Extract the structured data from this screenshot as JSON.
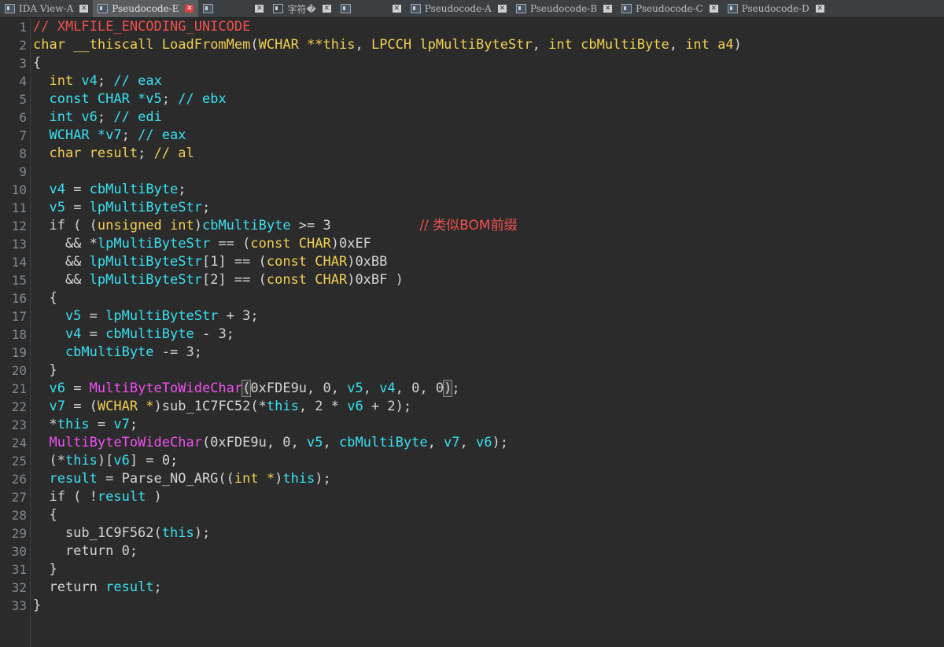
{
  "tabs": [
    {
      "label": "IDA View-A",
      "active": false,
      "icon": "ida-view-icon"
    },
    {
      "label": "Pseudocode-E",
      "active": true,
      "icon": "pseudocode-icon"
    },
    {
      "label": "",
      "active": false,
      "icon": "struct-icon"
    },
    {
      "label": "字符�",
      "active": false,
      "icon": "blank-icon"
    },
    {
      "label": "",
      "active": false,
      "icon": "hex-icon"
    },
    {
      "label": "Pseudocode-A",
      "active": false,
      "icon": "pseudocode-icon"
    },
    {
      "label": "Pseudocode-B",
      "active": false,
      "icon": "pseudocode-icon"
    },
    {
      "label": "Pseudocode-C",
      "active": false,
      "icon": "pseudocode-icon"
    },
    {
      "label": "Pseudocode-D",
      "active": false,
      "icon": "pseudocode-icon"
    }
  ],
  "close_glyph": "✕",
  "colors": {
    "comment": "#f05050",
    "keyword": "#f0d050",
    "variable": "#38e0f0",
    "function": "#f050f0",
    "text": "#d4d4d4",
    "background": "#2b2b2b"
  },
  "lines": [
    {
      "n": "1",
      "tokens": [
        {
          "t": "// XMLFILE_ENCODING_UNICODE",
          "c": "comment"
        }
      ]
    },
    {
      "n": "2",
      "tokens": [
        {
          "t": "char ",
          "c": "keyword"
        },
        {
          "t": "__thiscall ",
          "c": "keyword"
        },
        {
          "t": "LoadFromMem",
          "c": "keyword"
        },
        {
          "t": "(",
          "c": "plain"
        },
        {
          "t": "WCHAR **",
          "c": "keyword"
        },
        {
          "t": "this",
          "c": "keyword"
        },
        {
          "t": ", ",
          "c": "plain"
        },
        {
          "t": "LPCCH ",
          "c": "keyword"
        },
        {
          "t": "lpMultiByteStr",
          "c": "keyword"
        },
        {
          "t": ", ",
          "c": "plain"
        },
        {
          "t": "int ",
          "c": "keyword"
        },
        {
          "t": "cbMultiByte",
          "c": "keyword"
        },
        {
          "t": ", ",
          "c": "plain"
        },
        {
          "t": "int ",
          "c": "keyword"
        },
        {
          "t": "a4",
          "c": "keyword"
        },
        {
          "t": ")",
          "c": "plain"
        }
      ]
    },
    {
      "n": "3",
      "tokens": [
        {
          "t": "{",
          "c": "plain"
        }
      ]
    },
    {
      "n": "4",
      "tokens": [
        {
          "t": "  int ",
          "c": "keyword"
        },
        {
          "t": "v4",
          "c": "var"
        },
        {
          "t": "; ",
          "c": "plain"
        },
        {
          "t": "// eax",
          "c": "var"
        }
      ]
    },
    {
      "n": "5",
      "tokens": [
        {
          "t": "  const CHAR *",
          "c": "var"
        },
        {
          "t": "v5",
          "c": "var"
        },
        {
          "t": "; ",
          "c": "plain"
        },
        {
          "t": "// ebx",
          "c": "var"
        }
      ]
    },
    {
      "n": "6",
      "tokens": [
        {
          "t": "  int ",
          "c": "var"
        },
        {
          "t": "v6",
          "c": "var"
        },
        {
          "t": "; ",
          "c": "plain"
        },
        {
          "t": "// edi",
          "c": "var"
        }
      ]
    },
    {
      "n": "7",
      "tokens": [
        {
          "t": "  WCHAR *",
          "c": "var"
        },
        {
          "t": "v7",
          "c": "var"
        },
        {
          "t": "; ",
          "c": "plain"
        },
        {
          "t": "// eax",
          "c": "var"
        }
      ]
    },
    {
      "n": "8",
      "tokens": [
        {
          "t": "  char ",
          "c": "keyword"
        },
        {
          "t": "result",
          "c": "keyword"
        },
        {
          "t": "; ",
          "c": "plain"
        },
        {
          "t": "// al",
          "c": "keyword"
        }
      ]
    },
    {
      "n": "9",
      "tokens": []
    },
    {
      "n": "10",
      "tokens": [
        {
          "t": "  v4",
          "c": "var"
        },
        {
          "t": " = ",
          "c": "plain"
        },
        {
          "t": "cbMultiByte",
          "c": "var"
        },
        {
          "t": ";",
          "c": "plain"
        }
      ]
    },
    {
      "n": "11",
      "tokens": [
        {
          "t": "  v5",
          "c": "var"
        },
        {
          "t": " = ",
          "c": "plain"
        },
        {
          "t": "lpMultiByteStr",
          "c": "var"
        },
        {
          "t": ";",
          "c": "plain"
        }
      ]
    },
    {
      "n": "12",
      "tokens": [
        {
          "t": "  if ( (",
          "c": "plain"
        },
        {
          "t": "unsigned int",
          "c": "keyword"
        },
        {
          "t": ")",
          "c": "plain"
        },
        {
          "t": "cbMultiByte",
          "c": "var"
        },
        {
          "t": " >= 3           ",
          "c": "plain"
        },
        {
          "t": "// 类似BOM前缀",
          "c": "cmt"
        }
      ]
    },
    {
      "n": "13",
      "tokens": [
        {
          "t": "    && *",
          "c": "plain"
        },
        {
          "t": "lpMultiByteStr",
          "c": "var"
        },
        {
          "t": " == (",
          "c": "plain"
        },
        {
          "t": "const CHAR",
          "c": "keyword"
        },
        {
          "t": ")0xEF",
          "c": "plain"
        }
      ]
    },
    {
      "n": "14",
      "tokens": [
        {
          "t": "    && ",
          "c": "plain"
        },
        {
          "t": "lpMultiByteStr",
          "c": "var"
        },
        {
          "t": "[1] == (",
          "c": "plain"
        },
        {
          "t": "const CHAR",
          "c": "keyword"
        },
        {
          "t": ")0xBB",
          "c": "plain"
        }
      ]
    },
    {
      "n": "15",
      "tokens": [
        {
          "t": "    && ",
          "c": "plain"
        },
        {
          "t": "lpMultiByteStr",
          "c": "var"
        },
        {
          "t": "[2] == (",
          "c": "plain"
        },
        {
          "t": "const CHAR",
          "c": "keyword"
        },
        {
          "t": ")0xBF )",
          "c": "plain"
        }
      ]
    },
    {
      "n": "16",
      "tokens": [
        {
          "t": "  {",
          "c": "plain"
        }
      ]
    },
    {
      "n": "17",
      "tokens": [
        {
          "t": "    v5",
          "c": "var"
        },
        {
          "t": " = ",
          "c": "plain"
        },
        {
          "t": "lpMultiByteStr",
          "c": "var"
        },
        {
          "t": " + 3;",
          "c": "plain"
        }
      ]
    },
    {
      "n": "18",
      "tokens": [
        {
          "t": "    v4",
          "c": "var"
        },
        {
          "t": " = ",
          "c": "plain"
        },
        {
          "t": "cbMultiByte",
          "c": "var"
        },
        {
          "t": " - 3;",
          "c": "plain"
        }
      ]
    },
    {
      "n": "19",
      "tokens": [
        {
          "t": "    cbMultiByte",
          "c": "var"
        },
        {
          "t": " -= 3;",
          "c": "plain"
        }
      ]
    },
    {
      "n": "20",
      "tokens": [
        {
          "t": "  }",
          "c": "plain"
        }
      ]
    },
    {
      "n": "21",
      "tokens": [
        {
          "t": "  v6",
          "c": "var"
        },
        {
          "t": " = ",
          "c": "plain"
        },
        {
          "t": "MultiByteToWideChar",
          "c": "func"
        },
        {
          "t": "(",
          "c": "hl"
        },
        {
          "t": "0xFDE9u, 0, ",
          "c": "plain"
        },
        {
          "t": "v5",
          "c": "var"
        },
        {
          "t": ", ",
          "c": "plain"
        },
        {
          "t": "v4",
          "c": "var"
        },
        {
          "t": ", 0, 0",
          "c": "plain"
        },
        {
          "t": ")",
          "c": "hl"
        },
        {
          "t": ";",
          "c": "plain"
        }
      ]
    },
    {
      "n": "22",
      "tokens": [
        {
          "t": "  v7",
          "c": "var"
        },
        {
          "t": " = (",
          "c": "plain"
        },
        {
          "t": "WCHAR *",
          "c": "keyword"
        },
        {
          "t": ")sub_1C7FC52(*",
          "c": "plain"
        },
        {
          "t": "this",
          "c": "var"
        },
        {
          "t": ", 2 * ",
          "c": "plain"
        },
        {
          "t": "v6",
          "c": "var"
        },
        {
          "t": " + 2);",
          "c": "plain"
        }
      ]
    },
    {
      "n": "23",
      "tokens": [
        {
          "t": "  *",
          "c": "plain"
        },
        {
          "t": "this",
          "c": "var"
        },
        {
          "t": " = ",
          "c": "plain"
        },
        {
          "t": "v7",
          "c": "var"
        },
        {
          "t": ";",
          "c": "plain"
        }
      ]
    },
    {
      "n": "24",
      "tokens": [
        {
          "t": "  MultiByteToWideChar",
          "c": "func"
        },
        {
          "t": "(0xFDE9u, 0, ",
          "c": "plain"
        },
        {
          "t": "v5",
          "c": "var"
        },
        {
          "t": ", ",
          "c": "plain"
        },
        {
          "t": "cbMultiByte",
          "c": "var"
        },
        {
          "t": ", ",
          "c": "plain"
        },
        {
          "t": "v7",
          "c": "var"
        },
        {
          "t": ", ",
          "c": "plain"
        },
        {
          "t": "v6",
          "c": "var"
        },
        {
          "t": ");",
          "c": "plain"
        }
      ]
    },
    {
      "n": "25",
      "tokens": [
        {
          "t": "  (*",
          "c": "plain"
        },
        {
          "t": "this",
          "c": "var"
        },
        {
          "t": ")[",
          "c": "plain"
        },
        {
          "t": "v6",
          "c": "var"
        },
        {
          "t": "] = 0;",
          "c": "plain"
        }
      ]
    },
    {
      "n": "26",
      "tokens": [
        {
          "t": "  result",
          "c": "var"
        },
        {
          "t": " = Parse_NO_ARG((",
          "c": "plain"
        },
        {
          "t": "int *",
          "c": "keyword"
        },
        {
          "t": ")",
          "c": "plain"
        },
        {
          "t": "this",
          "c": "var"
        },
        {
          "t": ");",
          "c": "plain"
        }
      ]
    },
    {
      "n": "27",
      "tokens": [
        {
          "t": "  if ( !",
          "c": "plain"
        },
        {
          "t": "result",
          "c": "var"
        },
        {
          "t": " )",
          "c": "plain"
        }
      ]
    },
    {
      "n": "28",
      "tokens": [
        {
          "t": "  {",
          "c": "plain"
        }
      ]
    },
    {
      "n": "29",
      "tokens": [
        {
          "t": "    sub_1C9F562(",
          "c": "plain"
        },
        {
          "t": "this",
          "c": "var"
        },
        {
          "t": ");",
          "c": "plain"
        }
      ]
    },
    {
      "n": "30",
      "tokens": [
        {
          "t": "    return 0;",
          "c": "plain"
        }
      ]
    },
    {
      "n": "31",
      "tokens": [
        {
          "t": "  }",
          "c": "plain"
        }
      ]
    },
    {
      "n": "32",
      "tokens": [
        {
          "t": "  return ",
          "c": "plain"
        },
        {
          "t": "result",
          "c": "var"
        },
        {
          "t": ";",
          "c": "plain"
        }
      ]
    },
    {
      "n": "33",
      "tokens": [
        {
          "t": "}",
          "c": "plain"
        }
      ]
    }
  ]
}
